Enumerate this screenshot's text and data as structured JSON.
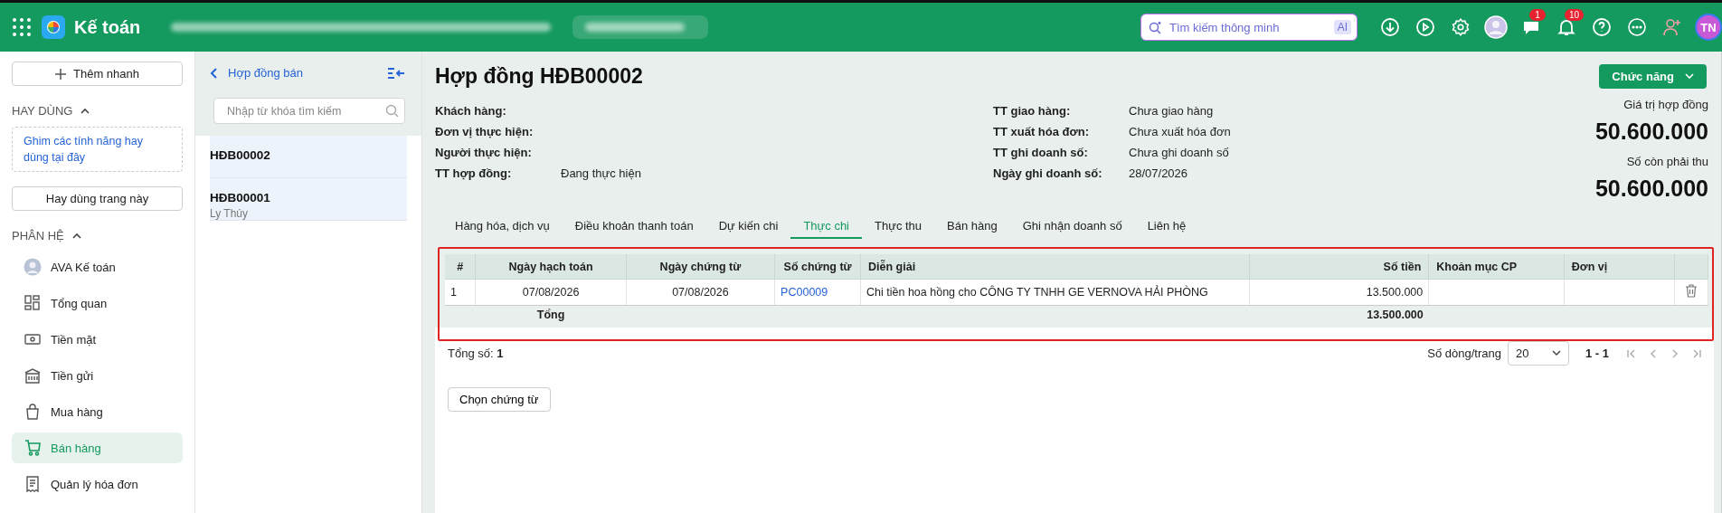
{
  "topbar": {
    "app_name": "Kế toán",
    "search": {
      "placeholder": "Tìm kiếm thông minh",
      "badge": "AI"
    },
    "tools": [
      {
        "kind": "download"
      },
      {
        "kind": "play"
      },
      {
        "kind": "settings"
      },
      {
        "kind": "avatar"
      },
      {
        "kind": "chat",
        "count": "1"
      },
      {
        "kind": "bell",
        "count": "10"
      },
      {
        "kind": "help"
      },
      {
        "kind": "more"
      },
      {
        "kind": "add-user"
      }
    ],
    "user_initials": "TN"
  },
  "sidebar": {
    "quick_add": "Thêm nhanh",
    "favorites": {
      "title": "HAY DÙNG",
      "expanded": true,
      "hint": "Ghim các tính năng hay dùng tại đây",
      "button": "Hay dùng trang này"
    },
    "modules": {
      "title": "PHÂN HỆ",
      "expanded": true,
      "items": [
        {
          "label": "AVA Kế toán",
          "kind": "avatar",
          "selected": false
        },
        {
          "label": "Tổng quan",
          "kind": "dashboard",
          "selected": false
        },
        {
          "label": "Tiền mặt",
          "kind": "cash",
          "selected": false
        },
        {
          "label": "Tiền gửi",
          "kind": "bank",
          "selected": false
        },
        {
          "label": "Mua hàng",
          "kind": "bag",
          "selected": false
        },
        {
          "label": "Bán hàng",
          "kind": "cart",
          "selected": true
        },
        {
          "label": "Quản lý hóa đơn",
          "kind": "receipt",
          "selected": false
        }
      ]
    }
  },
  "list_panel": {
    "title": "Hợp đồng bán",
    "search": {
      "placeholder": "Nhập từ khóa tìm kiếm"
    },
    "items": [
      {
        "code": "HĐB00002"
      },
      {
        "code": "HĐB00001",
        "subtitle": "Ly Thúy"
      }
    ]
  },
  "contract": {
    "title": "Hợp đồng HĐB00002",
    "actions_button": "Chức năng",
    "fields_left": [
      {
        "label": "Khách hàng:"
      },
      {
        "label": "Đơn vị thực hiện:"
      },
      {
        "label": "Người thực hiện:"
      },
      {
        "label": "TT hợp đồng:",
        "value": "Đang thực hiện"
      }
    ],
    "fields_right": [
      {
        "label": "TT giao hàng:",
        "value": "Chưa giao hàng"
      },
      {
        "label": "TT xuất hóa đơn:",
        "value": "Chưa xuất hóa đơn"
      },
      {
        "label": "TT ghi doanh số:",
        "value": "Chưa ghi doanh số"
      },
      {
        "label": "Ngày ghi doanh số:",
        "value": "28/07/2026"
      }
    ],
    "totals": [
      {
        "label": "Giá trị hợp đồng",
        "value": "50.600.000"
      },
      {
        "label": "Số còn phải thu",
        "value": "50.600.000"
      }
    ],
    "tabs": [
      {
        "label": "Hàng hóa, dịch vụ",
        "selected": false
      },
      {
        "label": "Điều khoản thanh toán",
        "selected": false
      },
      {
        "label": "Dự kiến chi",
        "selected": false
      },
      {
        "label": "Thực chi",
        "selected": true
      },
      {
        "label": "Thực thu",
        "selected": false
      },
      {
        "label": "Bán hàng",
        "selected": false
      },
      {
        "label": "Ghi nhận doanh số",
        "selected": false
      },
      {
        "label": "Liên hệ",
        "selected": false
      }
    ],
    "table": {
      "highlighted": true,
      "columns": [
        {
          "label": "#",
          "kind": "index"
        },
        {
          "label": "Ngày hạch toán",
          "kind": "date"
        },
        {
          "label": "Ngày chứng từ",
          "kind": "date"
        },
        {
          "label": "Số chứng từ",
          "kind": "link"
        },
        {
          "label": "Diễn giải",
          "kind": "text"
        },
        {
          "label": "Số tiền",
          "kind": "number"
        },
        {
          "label": "Khoản mục CP",
          "kind": "text"
        },
        {
          "label": "Đơn vị",
          "kind": "text"
        }
      ],
      "rows": [
        {
          "cells": [
            "1",
            "07/08/2026",
            "07/08/2026",
            "PC00009",
            "Chi tiền hoa hồng cho CÔNG TY TNHH GE VERNOVA HẢI PHÒNG",
            "13.500.000",
            "",
            ""
          ]
        }
      ],
      "total_label": "Tổng",
      "total_amount": "13.500.000"
    },
    "pagination": {
      "total_label": "Tổng số:",
      "total": "1",
      "page_size_label": "Số dòng/trang",
      "page_size": "20",
      "range": "1 - 1"
    },
    "choose_button": "Chọn chứng từ"
  }
}
